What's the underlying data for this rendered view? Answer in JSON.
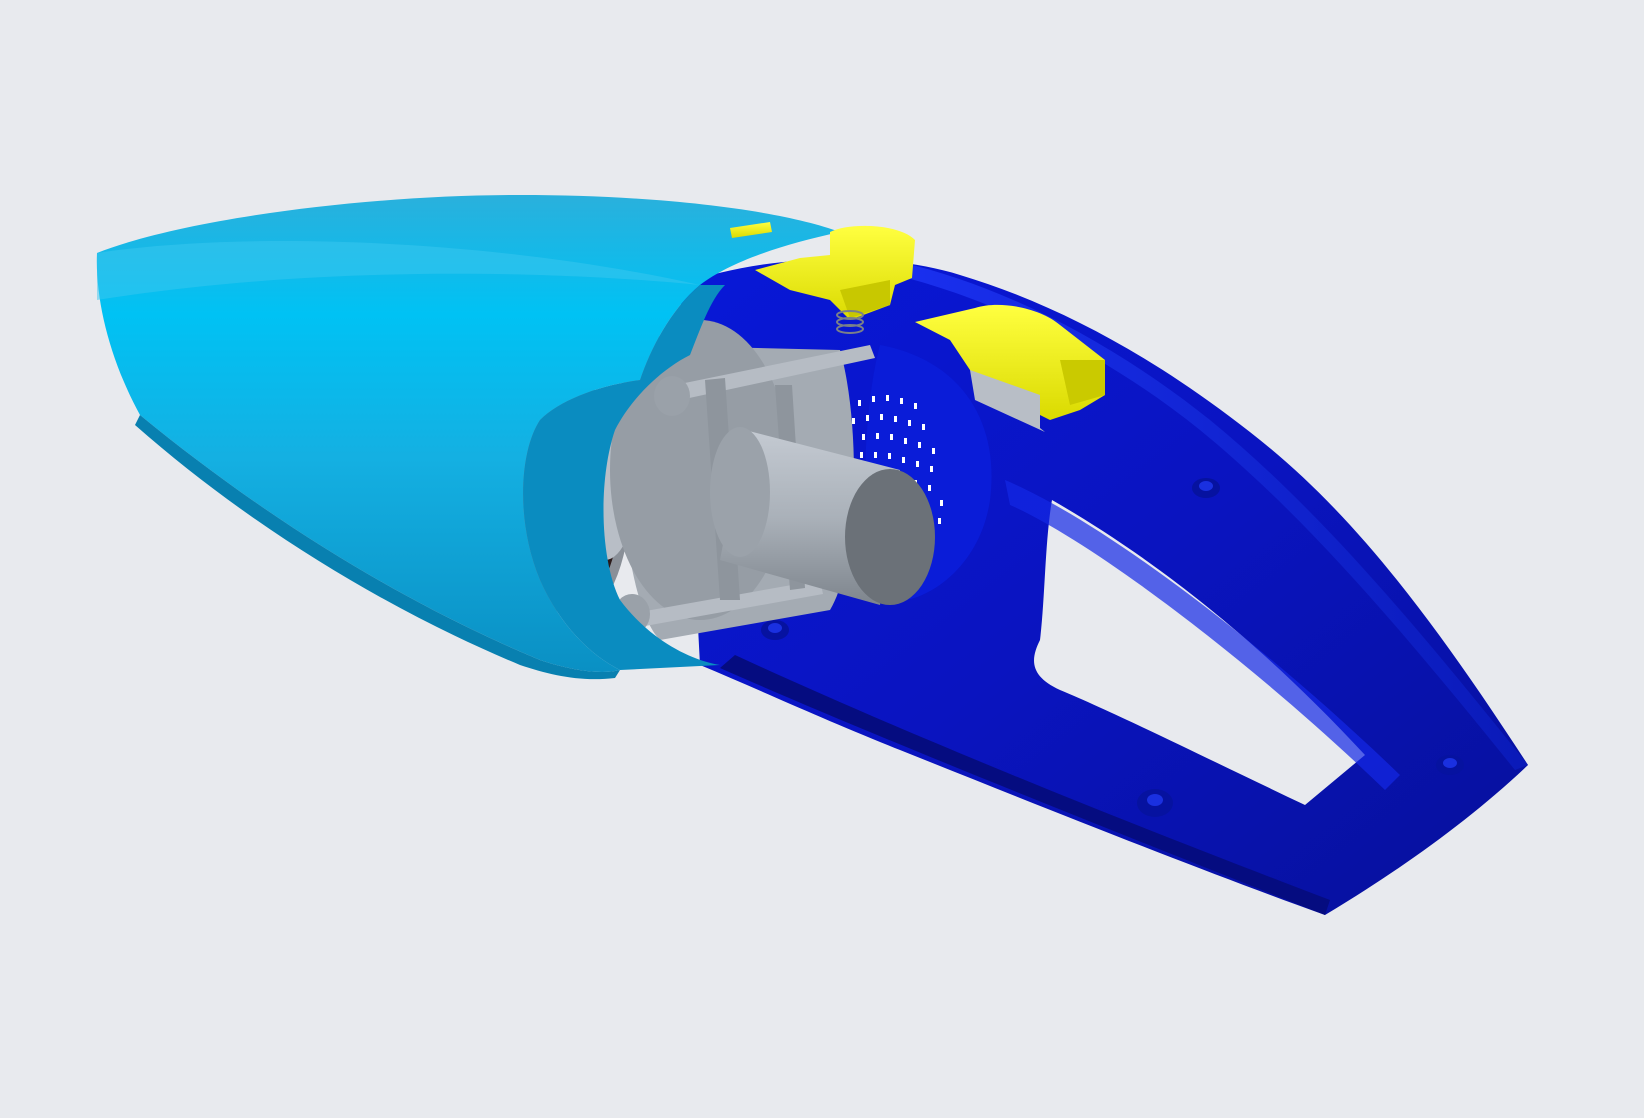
{
  "scene": {
    "background": "#e8eaee",
    "model": "handheld-vacuum-cutaway",
    "colors": {
      "nozzle_shell": "#1ab8e8",
      "nozzle_highlight": "#00c4f5",
      "nozzle_shadow": "#0a8fc0",
      "handle_body": "#0a12c8",
      "handle_light": "#2a3cf0",
      "handle_dark": "#050a8a",
      "motor_grey": "#a9b0b8",
      "motor_dark": "#6b7178",
      "latch_yellow": "#f5f500",
      "filter_dark": "#2a1a1a"
    },
    "icons": [
      "spring-icon",
      "screw-boss-icon",
      "vent-hole-icon"
    ]
  }
}
